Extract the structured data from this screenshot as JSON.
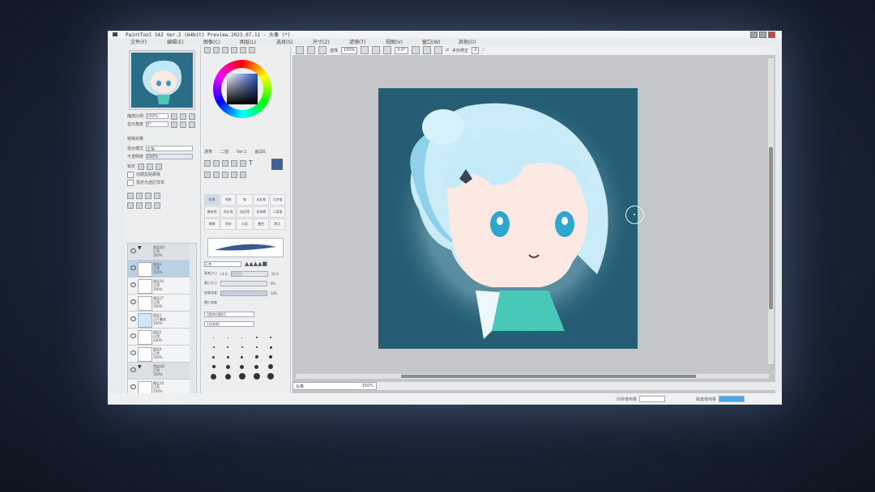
{
  "window": {
    "title": "PaintTool SAI Ver.2 (64bit) Preview.2023.07.11 - 头像 (*)",
    "buttons": [
      "minimize",
      "maximize",
      "close"
    ]
  },
  "menubar": [
    "文件(F)",
    "编辑(E)",
    "图像(C)",
    "图层(L)",
    "选择(S)",
    "尺寸(Z)",
    "滤镜(T)",
    "视图(V)",
    "窗口(W)",
    "其他(O)"
  ],
  "navigator": {
    "zoom_label": "缩放比例",
    "zoom_value": "150%",
    "angle_label": "显示角度",
    "angle_value": "0°"
  },
  "layer_panel": {
    "section_title": "特殊效果",
    "blend_label": "混合模式",
    "blend_value": "正常",
    "opacity_label": "不透明度",
    "opacity_value": "100%",
    "lock_label": "锁定",
    "clip_label": "创建剪贴蒙版",
    "select_source_label": "指定为选区样本",
    "layers": [
      {
        "name": "图层组1",
        "mode": "正常",
        "opacity": "100%",
        "type": "folder"
      },
      {
        "name": "图层3",
        "mode": "正常",
        "opacity": "100%",
        "type": "layer",
        "selected": true
      },
      {
        "name": "图层16",
        "mode": "正常",
        "opacity": "100%",
        "type": "layer"
      },
      {
        "name": "图层17",
        "mode": "正常",
        "opacity": "100%",
        "type": "layer"
      },
      {
        "name": "图层1",
        "mode": "正片叠底",
        "opacity": "100%",
        "type": "layer"
      },
      {
        "name": "图层5",
        "mode": "正常",
        "opacity": "100%",
        "type": "layer"
      },
      {
        "name": "图层4",
        "mode": "正常",
        "opacity": "100%",
        "type": "layer"
      },
      {
        "name": "图层组2",
        "mode": "正常",
        "opacity": "100%",
        "type": "folder"
      },
      {
        "name": "图层15",
        "mode": "正常",
        "opacity": "100%",
        "type": "layer"
      }
    ]
  },
  "color_panel": {
    "current_color": "#3e5f98",
    "tabs": [
      "通常",
      "二值",
      "Ver.1",
      "画具6"
    ]
  },
  "tools": {
    "items": [
      "铅笔",
      "喷枪",
      "笔",
      "水彩笔",
      "马克笔",
      "橡皮擦",
      "选区笔",
      "选区擦",
      "油漆桶",
      "二值笔",
      "模糊",
      "涂抹",
      "水彩",
      "叠色",
      "散点"
    ],
    "selected": "铅笔"
  },
  "brush": {
    "blend_mode": "正常",
    "size_label": "画笔大小",
    "size_multiplier": "x1.0",
    "size_value": "15.0",
    "min_size_label": "最小大小",
    "min_size_value": "0%",
    "density_label": "画笔浓度",
    "density_value": "100",
    "min_density_label": "最小浓度",
    "shape_label": "【通常的圆形】",
    "texture_label": "【无纹理】",
    "preset_sizes": [
      "0.7",
      "0.8",
      "1",
      "1.5",
      "2",
      "2.3",
      "2.6",
      "3",
      "3.5",
      "4",
      "5",
      "6",
      "7",
      "8",
      "9",
      "10",
      "12",
      "14",
      "16",
      "20",
      "25",
      "30",
      "35",
      "40",
      "50"
    ]
  },
  "canvas": {
    "select_label": "选择",
    "zoom": "150%",
    "angle": "0.0°",
    "stabilizer_label": "手抖修正",
    "stabilizer_value": "3"
  },
  "document_tab": {
    "name": "头像",
    "zoom": "150%"
  },
  "status": {
    "memory_label": "内存使用量",
    "disk_label": "磁盘使用量"
  }
}
